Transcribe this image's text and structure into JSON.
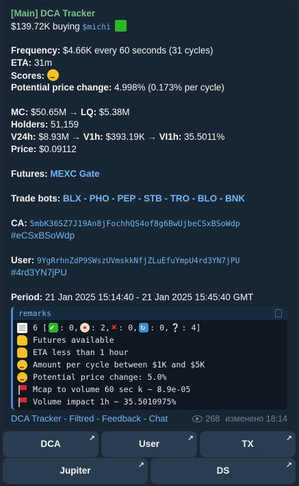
{
  "message": {
    "sender": "[Main] DCA Tracker",
    "headline_prefix": "$139.72K buying ",
    "headline_token": "$michi",
    "frequency_label": "Frequency:",
    "frequency_value": " $4.66K every 60 seconds (31 cycles)",
    "eta_label": "ETA:",
    "eta_value": " 31m",
    "scores_label": "Scores:",
    "ppc_label": "Potential price change:",
    "ppc_value": " 4.998% (0.173% per cycle)",
    "mc_label": "MC:",
    "mc_value": " $50.65M → ",
    "lq_label": "LQ:",
    "lq_value": " $5.38M",
    "holders_label": "Holders:",
    "holders_value": " 51,159",
    "v24_label": "V24h:",
    "v24_value": " $8.93M → ",
    "v1_label": "V1h:",
    "v1_value": " $393.19K → ",
    "vi1_label": "VI1h:",
    "vi1_value": " 35.5011%",
    "price_label": "Price:",
    "price_value": " $0.09112",
    "futures_label": "Futures:",
    "futures_links": [
      "MEXC",
      "Gate"
    ],
    "tradebots_label": "Trade bots:",
    "tradebots": [
      "BLX",
      "PHO",
      "PEP",
      "STB",
      "TRO",
      "BLO",
      "BNK"
    ],
    "ca_label": "CA:",
    "ca_value": "5mbK36SZ7J19An8jFochhQS4of8g6BwUjbeCSxBSoWdp",
    "ca_hashtag": "#eCSxBSoWdp",
    "user_label": "User:",
    "user_value": "9YgRrhnZdP9SWszUVmskkNfjZLuEfuYmpU4rd3YN7jPU",
    "user_hashtag": "#4rd3YN7jPU",
    "period_label": "Period:",
    "period_value": " 21 Jan 2025 15:14:40 - 21 Jan 2025 15:45:40 GMT"
  },
  "remarks": {
    "header": "remarks",
    "summary": {
      "count": "6 [",
      "check": ": 0, ",
      "clown": ": 2, ",
      "cross": ": 0, ",
      "cycle": ": 0, ",
      "question": ": 4]"
    },
    "lines": [
      {
        "icon": "thumbs-up-icon",
        "text": "Futures available"
      },
      {
        "icon": "thumbs-up-icon",
        "text": "ETA less than 1 hour"
      },
      {
        "icon": "thinking-face-icon",
        "text": "Amount per cycle between $1K and $5K"
      },
      {
        "icon": "thinking-face-icon",
        "text": "Potential price change: 5.0%"
      },
      {
        "icon": "red-flag-icon",
        "text": "Mcap to volume 60 sec k ~ 8.9e-05"
      },
      {
        "icon": "red-flag-icon",
        "text": "Volume impact 1h ~ 35.5010975%"
      }
    ]
  },
  "footer": {
    "links": [
      "DCA Tracker",
      "Filtred",
      "Feedback",
      "Chat"
    ],
    "views": "268",
    "edited": "изменено 18:14"
  },
  "keyboard": {
    "row1": [
      "DCA",
      "User",
      "TX"
    ],
    "row2": [
      "Jupiter",
      "DS"
    ],
    "arrow": "↗"
  },
  "colors": {
    "background": "#1d2733",
    "bubble": "#182533",
    "link": "#71b6f2",
    "sender": "#7cc08b"
  }
}
